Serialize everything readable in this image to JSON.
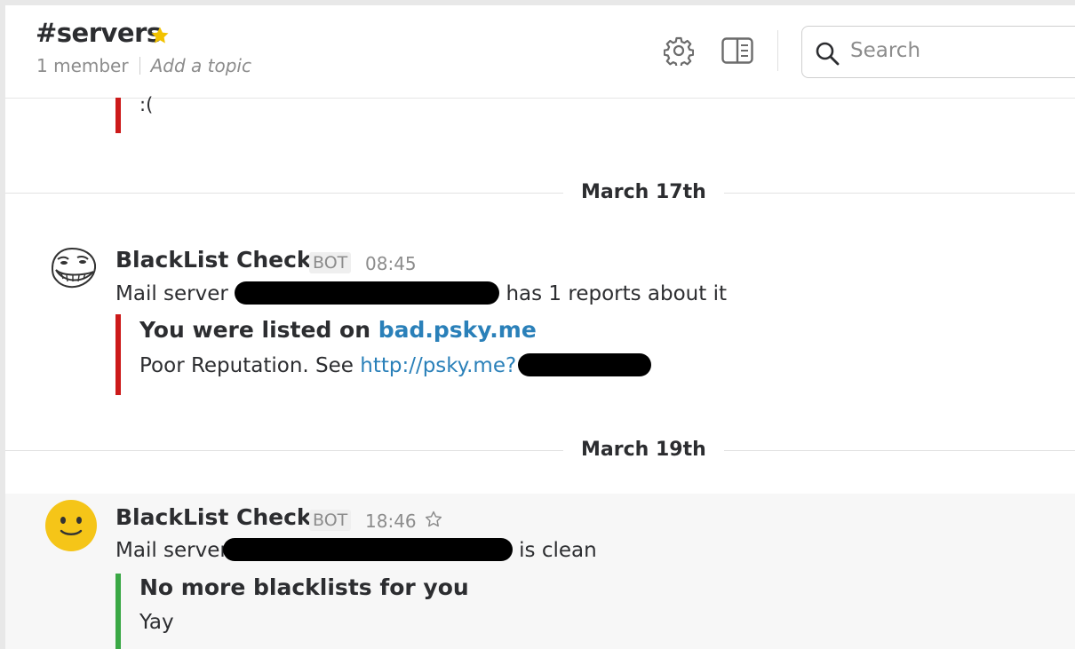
{
  "header": {
    "channel": "#servers",
    "members": "1 member",
    "topic_placeholder": "Add a topic",
    "search_placeholder": "Search"
  },
  "previous_attachment": {
    "text": ":("
  },
  "days": [
    {
      "label": "March 17th"
    },
    {
      "label": "March 19th"
    }
  ],
  "messages": [
    {
      "sender": "BlackList Checker",
      "badge": "BOT",
      "time": "08:45",
      "text_before": "Mail server",
      "text_after": "has 1 reports about it",
      "attachment": {
        "title_prefix": "You were listed on",
        "title_link": "bad.psky.me",
        "text_prefix": "Poor Reputation. See",
        "text_link": "http://psky.me?",
        "bar_color": "#cc1a1a"
      }
    },
    {
      "sender": "BlackList Checker",
      "badge": "BOT",
      "time": "18:46",
      "text_before": "Mail server",
      "text_after": "is clean",
      "attachment": {
        "title": "No more blacklists for you",
        "text": "Yay",
        "bar_color": "#3aa845"
      }
    }
  ],
  "colors": {
    "link": "#2a80b9",
    "star": "#f2c200"
  }
}
